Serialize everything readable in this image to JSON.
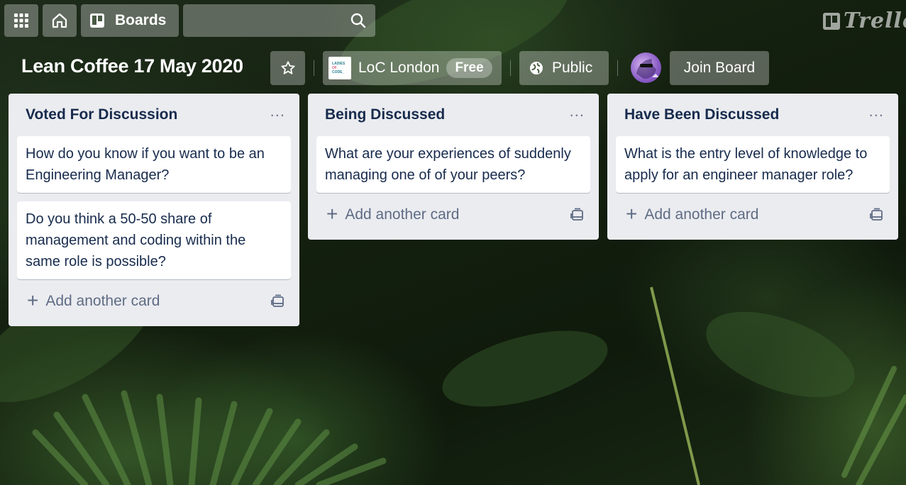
{
  "topbar": {
    "boards_label": "Boards",
    "search": {
      "value": "",
      "placeholder": ""
    },
    "logo_text": "Trello"
  },
  "board": {
    "title": "Lean Coffee 17 May 2020",
    "team_name": "LoC London",
    "team_badge": "Free",
    "team_logo_lines": [
      "LADIES",
      "OF",
      "CODE_"
    ],
    "visibility": "Public",
    "join_label": "Join Board"
  },
  "lists": [
    {
      "title": "Voted For Discussion",
      "cards": [
        "How do you know if you want to be an Engineering Manager?",
        "Do you think a 50-50 share of management and coding within the same role is possible?"
      ],
      "add_label": "Add another card"
    },
    {
      "title": "Being Discussed",
      "cards": [
        "What are your experiences of suddenly managing one of of your peers?"
      ],
      "add_label": "Add another card"
    },
    {
      "title": "Have Been Discussed",
      "cards": [
        "What is the entry level of knowledge to apply for an engineer manager role?"
      ],
      "add_label": "Add another card"
    }
  ],
  "icons": {
    "apps": "grid-icon",
    "home": "home-icon",
    "boards": "board-icon",
    "search": "search-icon",
    "star": "star-icon",
    "public": "globe-icon",
    "list_menu": "ellipsis-icon",
    "template": "card-template-icon"
  },
  "colors": {
    "list_bg": "#ebecf0",
    "card_text": "#172b4d",
    "muted_text": "#5e6c84"
  }
}
